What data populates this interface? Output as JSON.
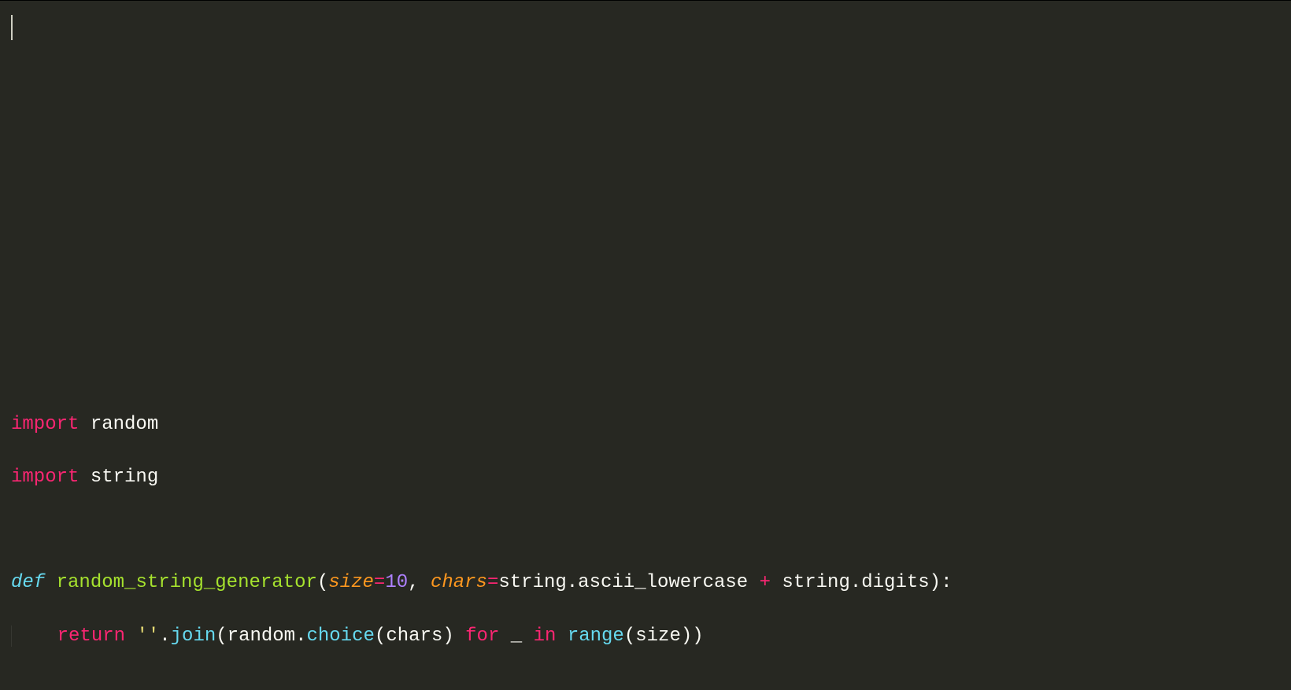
{
  "code": {
    "tokens": {
      "import1": "import",
      "random_mod": " random",
      "import2": "import",
      "string_mod": " string",
      "def_kw": "def",
      "func_name": "random_string_generator",
      "lparen1": "(",
      "param_size": "size",
      "eq1": "=",
      "num_10": "10",
      "comma1": ", ",
      "param_chars": "chars",
      "eq2": "=",
      "string_ascii": "string.ascii_lowercase ",
      "plus": "+",
      "string_digits": " string.digits",
      "rparen_colon1": ")",
      "colon1": ":",
      "indent1": "    ",
      "return_kw": "return",
      "space1": " ",
      "empty_str": "''",
      "dot1": ".",
      "join_call": "join",
      "lparen2": "(",
      "random_obj": "random.",
      "choice_call": "choice",
      "lparen3": "(",
      "chars_arg": "chars",
      "rparen3": ") ",
      "for_kw": "for",
      "underscore": " _ ",
      "in_kw": "in",
      "space2": " ",
      "range_call": "range",
      "lparen4": "(",
      "size_arg": "size",
      "rparen4": ")",
      "rparen2": ")"
    }
  }
}
